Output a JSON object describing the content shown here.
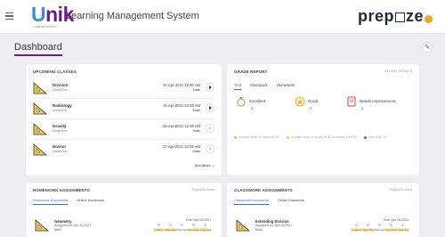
{
  "header": {
    "logo_text": "Unik",
    "logo_tagline": "A PREPEZE PRODUCT",
    "app_title": "Learning Management System",
    "brand": "prepaze"
  },
  "page": {
    "title": "Dashboard"
  },
  "upcoming": {
    "title": "UPCOMING CLASSES",
    "see_more": "See More ...",
    "classes": [
      {
        "name": "Division",
        "teacher": "Linke Din",
        "date": "15-Apr-2021 12:00 AM",
        "subject": "Math"
      },
      {
        "name": "Radiology",
        "teacher": "Linke Din",
        "date": "15-Apr-2021 12:00 AM",
        "subject": "Math"
      },
      {
        "name": "Gravity",
        "teacher": "Linke Din",
        "date": "16-Apr-2021 12:00 AM",
        "subject": "Math"
      },
      {
        "name": "Divisor",
        "teacher": "Linke Din",
        "date": "17-Apr-2021 12:00 AM",
        "subject": "Math"
      }
    ]
  },
  "grade": {
    "title": "GRADE REPORT",
    "link": "IN LAST 30 DAYS",
    "tabs": [
      "Test",
      "Classwork",
      "Homework"
    ],
    "items": [
      {
        "label": "Excellent",
        "count": "3",
        "color": "#7cb342"
      },
      {
        "label": "Good",
        "count": "2",
        "color": "#f0b429"
      },
      {
        "label": "Needs Improvement",
        "count": "3",
        "color": "#e53935"
      }
    ],
    "legend": [
      {
        "label": "Greater than or equal to 30",
        "color": "#a5d66b"
      },
      {
        "label": "Greater than or equal to 30 and less than 90",
        "color": "#f5c842"
      },
      {
        "label": "less than 70",
        "color": "#e53935"
      }
    ]
  },
  "homework": {
    "title": "HOMEWORK ASSIGNMENTS",
    "link": "Project to learn",
    "tabs": [
      "Homework Documents",
      "Online Homework"
    ],
    "item": {
      "name": "Geometry",
      "assigned": "Assigned on: Apr 15,2021",
      "subject": "Math",
      "due": "Due: Apr 16,2021",
      "stats": [
        {
          "n": "0",
          "label": "Graded"
        },
        {
          "n": "0",
          "label": "Past Due"
        },
        {
          "n": "0",
          "label": "Returned"
        },
        {
          "n": "0",
          "label": "Submitted"
        },
        {
          "n": "1",
          "label": "Assigned"
        }
      ]
    }
  },
  "classwork": {
    "title": "CLASSWORK ASSIGNMENTS",
    "link": "Project to learn",
    "tabs": [
      "Classwork Documents",
      "Online Classwork"
    ],
    "item": {
      "name": "Extending Division",
      "assigned": "Assigned on: Apr 15,2021",
      "subject": "Math",
      "due": "Due: Apr 16,2021",
      "stats": [
        {
          "n": "0",
          "label": "Graded"
        },
        {
          "n": "0",
          "label": "Past Due"
        },
        {
          "n": "0",
          "label": "Returned"
        },
        {
          "n": "0",
          "label": "Submitted"
        },
        {
          "n": "1",
          "label": "Assigned"
        }
      ]
    }
  }
}
